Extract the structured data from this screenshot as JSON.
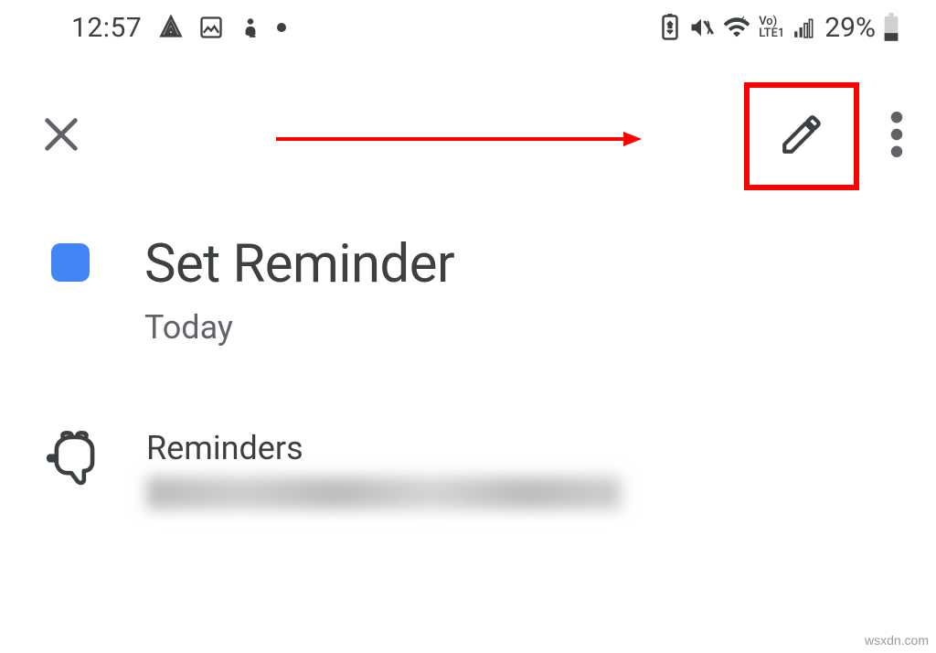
{
  "status_bar": {
    "time": "12:57",
    "battery_percent": "29%",
    "network_label_top": "Vo)",
    "network_label_bottom": "LTE1"
  },
  "app_bar": {
    "close": "close",
    "edit": "edit",
    "overflow": "more"
  },
  "reminder": {
    "title": "Set Reminder",
    "subtitle": "Today",
    "color": "#4285f4"
  },
  "category": {
    "label": "Reminders"
  },
  "annotation": {
    "highlight_target": "edit-button"
  },
  "watermark": "wsxdn.com"
}
